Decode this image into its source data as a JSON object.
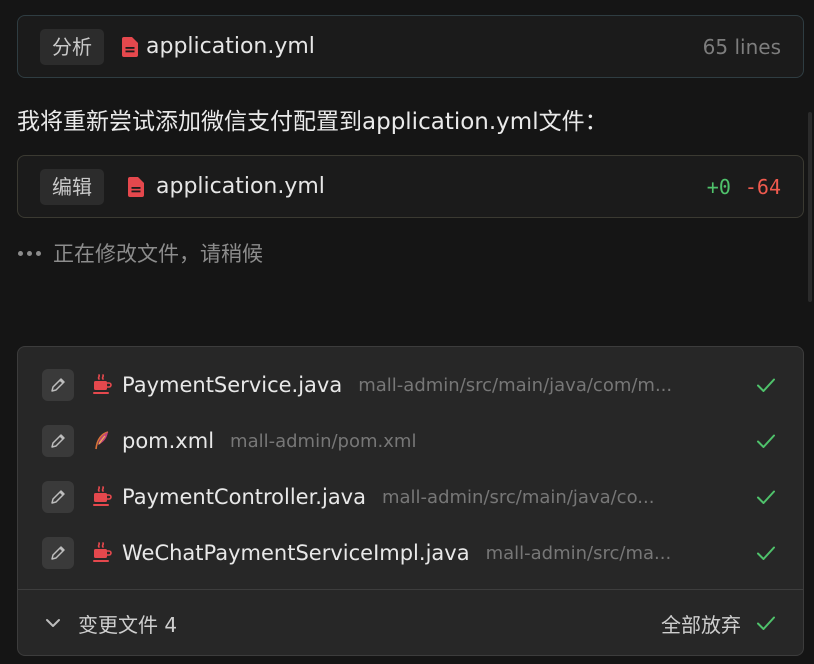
{
  "card_analyze": {
    "tag": "分析",
    "file": "application.yml",
    "meta": "65 lines"
  },
  "message": "我将重新尝试添加微信支付配置到application.yml文件：",
  "card_edit": {
    "tag": "编辑",
    "file": "application.yml",
    "added": "+0",
    "removed": "-64"
  },
  "status": "正在修改文件，请稍候",
  "changes": {
    "files": [
      {
        "name": "PaymentService.java",
        "path": "mall-admin/src/main/java/com/m...",
        "icon": "java-icon"
      },
      {
        "name": "pom.xml",
        "path": "mall-admin/pom.xml",
        "icon": "feather-icon"
      },
      {
        "name": "PaymentController.java",
        "path": "mall-admin/src/main/java/co...",
        "icon": "java-icon"
      },
      {
        "name": "WeChatPaymentServiceImpl.java",
        "path": "mall-admin/src/ma...",
        "icon": "java-icon"
      }
    ],
    "footer_label": "变更文件 4",
    "discard_label": "全部放弃"
  },
  "colors": {
    "added": "#4fc26b",
    "removed": "#ef5a4e",
    "check": "#4fc26b",
    "file_icon": "#e5484d"
  }
}
